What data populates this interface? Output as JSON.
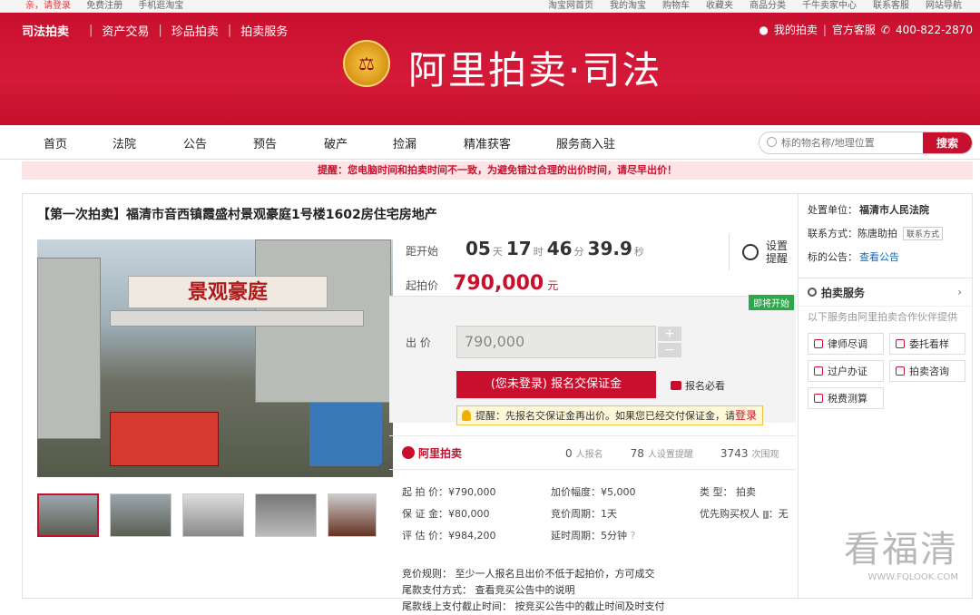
{
  "topbar": {
    "login": "亲，请登录",
    "register": "免费注册",
    "mobile": "手机逛淘宝",
    "links": [
      "淘宝网首页",
      "我的淘宝",
      "购物车",
      "收藏夹",
      "商品分类",
      "千牛卖家中心",
      "联系客服",
      "网站导航"
    ]
  },
  "banner": {
    "logo": "司法拍卖",
    "nav": [
      "资产交易",
      "珍品拍卖",
      "拍卖服务"
    ],
    "my_auction": "我的拍卖",
    "service": "官方客服",
    "phone": "400-822-2870",
    "title": "阿里拍卖·司法"
  },
  "menu": {
    "items": [
      "首页",
      "法院",
      "公告",
      "预告",
      "破产",
      "捡漏",
      "精准获客",
      "服务商入驻"
    ],
    "search_placeholder": "标的物名称/地理位置",
    "search_button": "搜索"
  },
  "notice": "提醒：您电脑时间和拍卖时间不一致，为避免错过合理的出价时间，请尽早出价！",
  "product": {
    "title": "【第一次拍卖】福清市音西镇霞盛村景观豪庭1号楼1602房住宅房地产",
    "sign_text": "景观豪庭"
  },
  "countdown": {
    "label": "距开始",
    "days": "05",
    "days_u": "天",
    "hours": "17",
    "hours_u": "时",
    "minutes": "46",
    "minutes_u": "分",
    "seconds": "39.9",
    "seconds_u": "秒",
    "remind": "设置提醒"
  },
  "start_price": {
    "label": "起拍价",
    "value": "790,000",
    "unit": "元"
  },
  "bid": {
    "badge": "即将开始",
    "label": "出  价",
    "value": "790,000",
    "plus": "+",
    "minus": "−",
    "register_button": "(您未登录) 报名交保证金",
    "must_read": "报名必看",
    "tip": "提醒：先报名交保证金再出价。如果您已经交付保证金，请",
    "tip_login": "登录"
  },
  "stats": {
    "brand": "阿里拍卖",
    "signed": "0",
    "signed_t": "人报名",
    "reminders": "78",
    "reminders_t": "人设置提醒",
    "views": "3743",
    "views_t": "次围观"
  },
  "details": {
    "start": "起 拍 价：¥790,000",
    "increment": "加价幅度：¥5,000",
    "type": "类      型：  拍卖",
    "deposit": "保 证 金：¥80,000",
    "period": "竞价周期：1天",
    "priority": "优先购买权人",
    "priority_v": "：无",
    "appraisal": "评 估 价：¥984,200",
    "delay": "延时周期：5分钟"
  },
  "rules": [
    "竞价规则：  至少一人报名且出价不低于起拍价，方可成交",
    "尾款支付方式：  查看竞买公告中的说明",
    "尾款线上支付截止时间：  按竞买公告中的截止时间及时支付"
  ],
  "side": {
    "court_label": "处置单位：",
    "court": "福清市人民法院",
    "contact_label": "联系方式：",
    "contact": "陈唐助拍",
    "contact_tag": "联系方式",
    "notice_label": "标的公告：",
    "notice_link": "查看公告",
    "service_title": "拍卖服务",
    "service_desc": "以下服务由阿里拍卖合作伙伴提供",
    "buttons": [
      "律师尽调",
      "委托看样",
      "过户办证",
      "拍卖咨询",
      "税费测算"
    ]
  },
  "watermark": {
    "text": "看福清",
    "url": "WWW.FQLOOK.COM"
  }
}
